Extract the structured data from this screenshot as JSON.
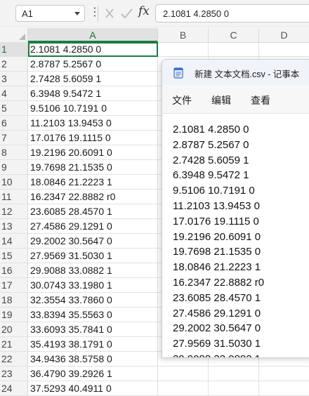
{
  "formula_bar": {
    "name_box": "A1",
    "more_icon": "⋮",
    "cancel_icon": "close-icon",
    "enter_icon": "checkmark-icon",
    "fx_label": "fx",
    "formula_value": "2.1081 4.2850 0"
  },
  "sheet": {
    "columns": [
      "A",
      "B",
      "C",
      "D"
    ],
    "rows": [
      {
        "n": "1",
        "a": "2.1081 4.2850 0"
      },
      {
        "n": "2",
        "a": "2.8787 5.2567 0"
      },
      {
        "n": "3",
        "a": "2.7428 5.6059 1"
      },
      {
        "n": "4",
        "a": "6.3948 9.5472 1"
      },
      {
        "n": "5",
        "a": "9.5106 10.7191 0"
      },
      {
        "n": "6",
        "a": "11.2103 13.9453 0"
      },
      {
        "n": "7",
        "a": "17.0176 19.1115 0"
      },
      {
        "n": "8",
        "a": "19.2196 20.6091 0"
      },
      {
        "n": "9",
        "a": "19.7698 21.1535 0"
      },
      {
        "n": "10",
        "a": "18.0846 21.2223 1"
      },
      {
        "n": "11",
        "a": "16.2347 22.8882 r0"
      },
      {
        "n": "12",
        "a": "23.6085 28.4570 1"
      },
      {
        "n": "13",
        "a": "27.4586 29.1291 0"
      },
      {
        "n": "14",
        "a": "29.2002 30.5647 0"
      },
      {
        "n": "15",
        "a": "27.9569 31.5030 1"
      },
      {
        "n": "16",
        "a": "29.9088 33.0882 1"
      },
      {
        "n": "17",
        "a": "30.0743 33.1980 1"
      },
      {
        "n": "18",
        "a": "32.3554 33.7860 0"
      },
      {
        "n": "19",
        "a": "33.8394 35.5563 0"
      },
      {
        "n": "20",
        "a": "33.6093 35.7841 0"
      },
      {
        "n": "21",
        "a": "35.4193 38.1791 0"
      },
      {
        "n": "22",
        "a": "34.9436 38.5758 0"
      },
      {
        "n": "23",
        "a": "36.4790 39.2926 1"
      },
      {
        "n": "24",
        "a": "37.5293 40.4911 0"
      }
    ]
  },
  "notepad": {
    "icon": "notepad-icon",
    "title": "新建 文本文档.csv - 记事本",
    "menu": [
      "文件",
      "编辑",
      "查看"
    ],
    "lines": [
      "2.1081 4.2850 0",
      "2.8787 5.2567 0",
      "2.7428 5.6059 1",
      "6.3948 9.5472 1",
      "9.5106 10.7191 0",
      "11.2103 13.9453 0",
      "17.0176 19.1115 0",
      "19.2196 20.6091 0",
      "19.7698 21.1535 0",
      "18.0846 21.2223 1",
      "16.2347 22.8882 r0",
      "23.6085 28.4570 1",
      "27.4586 29.1291 0",
      "29.2002 30.5647 0",
      "27.9569 31.5030 1",
      "29.9088 33.0882 1"
    ]
  },
  "colors": {
    "excel_green": "#1f7a45",
    "header_bg": "#f3f3f3",
    "notepad_titlebar": "#f0f3f9"
  }
}
